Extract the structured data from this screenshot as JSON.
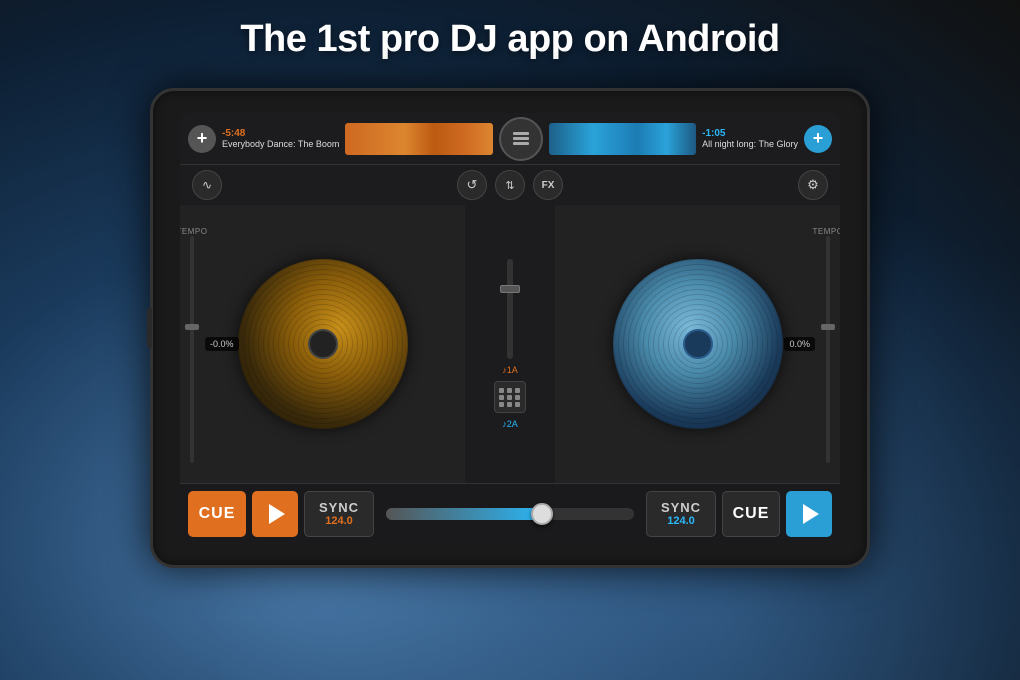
{
  "headline": "The 1st pro DJ app on Android",
  "tablet": {
    "top_bar": {
      "add_left": "+",
      "add_right": "+",
      "track_left": {
        "time": "-5:48",
        "name": "Everybody Dance: The Boom"
      },
      "track_right": {
        "time": "-1:05",
        "name": "All night long: The Glory"
      }
    },
    "controls": {
      "wave_icon": "〜",
      "loop_icon": "↺",
      "eq_icon": "⇕",
      "fx_label": "FX",
      "settings_icon": "⚙"
    },
    "deck_left": {
      "pitch": "-0.0%",
      "key": "♪1A"
    },
    "deck_right": {
      "pitch": "0.0%",
      "key": "♪2A"
    },
    "bottom": {
      "cue_left": "CUE",
      "sync_left_label": "SYNC",
      "sync_left_bpm": "124.0",
      "sync_right_label": "SYNC",
      "sync_right_bpm": "124.0",
      "cue_right": "CUE",
      "tempo_label": "TEMPO"
    }
  }
}
